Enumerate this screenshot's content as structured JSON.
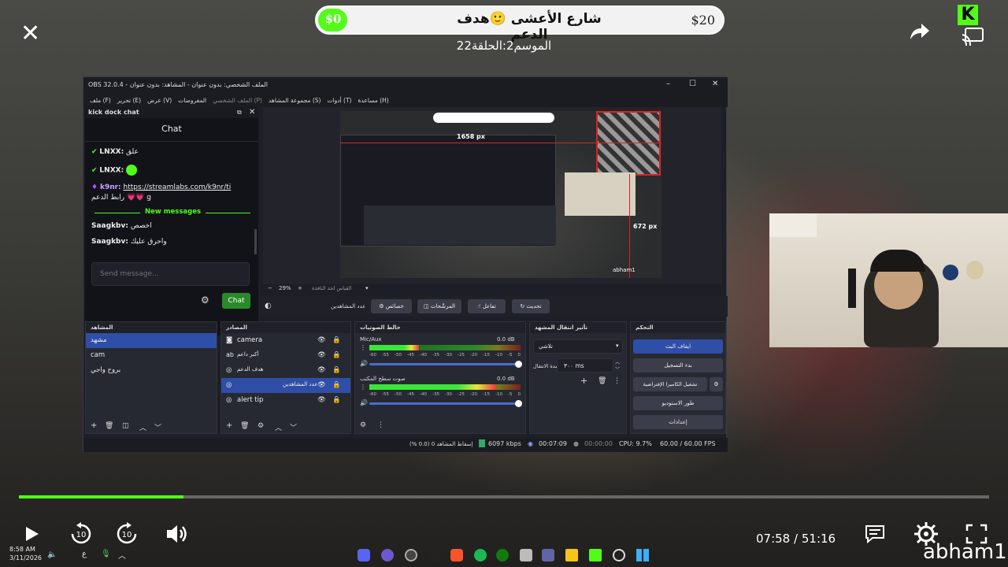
{
  "overlay": {
    "goal_min": "$0",
    "goal_max": "$20",
    "goal_title": "شارع الأعشى 🙂هدف الدعم",
    "subtitle": "الموسم2:الحلقة22",
    "accent": "#53fc18"
  },
  "obs": {
    "window_title": "OBS 32.0.4 - الملف الشخصي: بدون عنوان - المشاهد: بدون عنوان",
    "menu": [
      "ملف (F)",
      "تحرير (E)",
      "عرض (V)",
      "المفروضات",
      "الملف الشخصي (P)",
      "مجموعة المشاهد (S)",
      "أدوات (T)",
      "مساعدة (H)"
    ],
    "dock": {
      "title": "kick dock chat",
      "header": "Chat",
      "messages": [
        {
          "user": "LNXX:",
          "text": "علق"
        },
        {
          "user": "LNXX:",
          "text": ""
        },
        {
          "user": "k9nr:",
          "text": "https://streamlabs.com/k9nr/ti"
        },
        {
          "user": "",
          "text": "رابط الدعم 💗💗 g"
        }
      ],
      "new_messages": "New messages",
      "messages2": [
        {
          "user": "Saagkbv:",
          "text": "اخصص"
        },
        {
          "user": "Saagkbv:",
          "text": "واحرق عليك"
        }
      ],
      "send_placeholder": "Send message...",
      "chat_button": "Chat"
    },
    "preview": {
      "width_label": "1658 px",
      "height_label": "672 px",
      "zoom": "29%",
      "scale_label": "القياس لحد النافذة",
      "watermark": "abham1"
    },
    "toolbar": {
      "selected_source": "عدد المشاهدين",
      "properties": "خصائص",
      "filters": "المرشّحات",
      "interact": "تفاعل",
      "refresh": "تحديث"
    },
    "scenes": {
      "title": "المشاهد",
      "items": [
        "مشهد",
        "cam",
        "بروح واجي"
      ]
    },
    "sources": {
      "title": "المصادر",
      "items": [
        "camera",
        "أكبر داعم",
        "هدف الدعم",
        "عدد المشاهدين",
        "alert tip"
      ]
    },
    "mixer": {
      "title": "خالط الصوتيات",
      "channels": [
        {
          "name": "Mic/Aux",
          "db": "0.0 dB",
          "level": 0.33
        },
        {
          "name": "صوت سطح المكتب",
          "db": "0.0 dB",
          "level": 0.84
        }
      ],
      "ticks": [
        "-60",
        "-55",
        "-50",
        "-45",
        "-40",
        "-35",
        "-30",
        "-25",
        "-20",
        "-15",
        "-10",
        "-5",
        "0"
      ]
    },
    "transitions": {
      "title": "تأثير انتقال المشهد",
      "type": "تلاشي",
      "duration_label": "مدة الانتقال",
      "duration": "٣٠٠ ms"
    },
    "controls": {
      "title": "التحكم",
      "stop_stream": "ايقاف البث",
      "start_record": "بدء التسجيل",
      "virtual_cam": "تشغيل الكاميرا الإفتراضية",
      "studio_mode": "طور الاستوديو",
      "settings": "إعدادات"
    },
    "status": {
      "dropped": "إسقاط المشاهد 0 (0.0 %)",
      "bitrate": "6097 kbps",
      "stream_time": "00:07:09",
      "rec_time": "00:00:00",
      "cpu": "CPU: 9.7%",
      "fps": "60.00 / 60.00 FPS"
    }
  },
  "player": {
    "current_time": "07:58",
    "separator": "/",
    "duration": "51:16",
    "progress": 0.17,
    "channel": "abham1"
  },
  "taskbar": {
    "time": "8:58 AM",
    "date": "3/11/2026",
    "lang": "ع"
  }
}
